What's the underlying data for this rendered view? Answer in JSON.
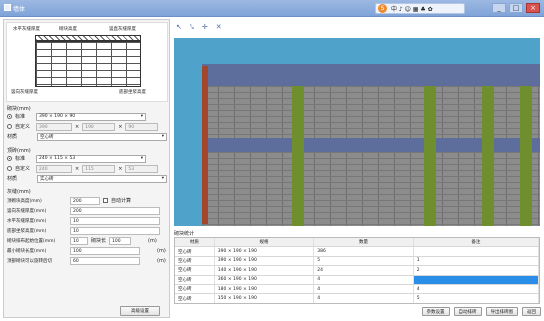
{
  "window": {
    "title": "墙体",
    "controls": [
      "_",
      "□",
      "×"
    ]
  },
  "ime": {
    "logo": "S",
    "text": "中 ♪ ☺ ▦ ♣ ✿"
  },
  "schematic": {
    "labels": [
      "水平灰缝厚度",
      "砌块高度",
      "竖直灰缝厚度",
      "顶部砌块宽度",
      "砌块长度",
      "竖向灰缝厚度",
      "底部坐浆高度"
    ]
  },
  "block_section": {
    "title": "砌块(mm)",
    "standard_label": "标准",
    "standard_value": "390 × 190 × 90",
    "custom_label": "自定义",
    "custom_values": [
      "390",
      "190",
      "90"
    ],
    "material_label": "材质",
    "material_value": "空心砖"
  },
  "top_block_section": {
    "title": "顶砖(mm)",
    "standard_label": "标准",
    "standard_value": "240 × 115 × 53",
    "custom_label": "自定义",
    "custom_values": [
      "240",
      "115",
      "53"
    ],
    "material_label": "材质",
    "material_value": "实心砖"
  },
  "joint_section": {
    "title": "灰缝(mm)",
    "params": [
      {
        "label": "顶砌块高度(mm)",
        "value": "200",
        "extra": "自动计算"
      },
      {
        "label": "竖向灰缝厚度(mm)",
        "value": "200"
      },
      {
        "label": "水平灰缝厚度(mm)",
        "value": "10"
      },
      {
        "label": "底部坐浆高度(mm)",
        "value": "10"
      },
      {
        "label": "砌块排布起始位置(mm)",
        "value": "10",
        "mid_label": "砌块长",
        "mid_value": "100",
        "unit": "(m)"
      },
      {
        "label": "最小砌块长度(mm)",
        "value": "100",
        "unit": "(m)"
      },
      {
        "label": "顶部砌块可以旋转后切",
        "value": "60",
        "unit": "(m)"
      }
    ],
    "button": "高级设置"
  },
  "toolbar": {
    "icons": [
      "move-icon",
      "pick-icon",
      "add-icon",
      "delete-icon"
    ]
  },
  "result": {
    "title": "砌块统计",
    "columns": [
      "材质",
      "规格",
      "数量",
      "备注"
    ],
    "rows": [
      [
        "空心砖",
        "390 × 190 × 190",
        "386",
        ""
      ],
      [
        "空心砖",
        "390 × 190 × 190",
        "5",
        "1"
      ],
      [
        "空心砖",
        "140 × 190 × 190",
        "24",
        "2"
      ],
      [
        "空心砖",
        "360 × 190 × 190",
        "4",
        ""
      ],
      [
        "空心砖",
        "180 × 190 × 190",
        "4",
        "4"
      ],
      [
        "空心砖",
        "150 × 190 × 190",
        "4",
        "5"
      ]
    ],
    "buttons": [
      "参数设置",
      "自动排砖",
      "导出排砖图",
      "返回"
    ]
  }
}
